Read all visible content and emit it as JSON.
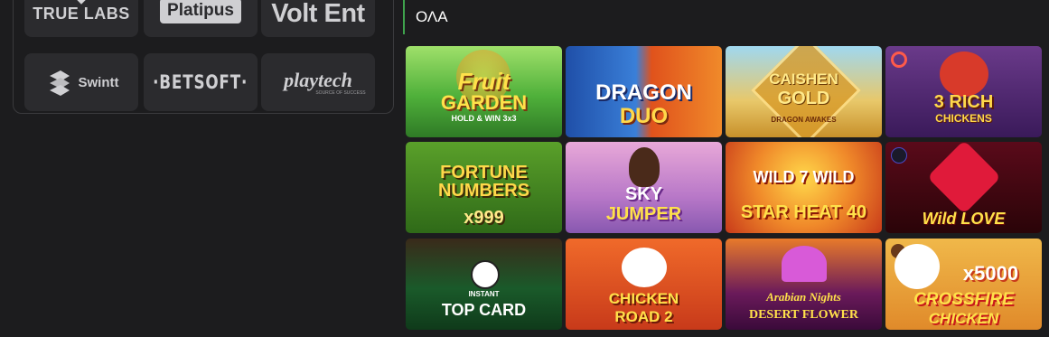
{
  "providers": {
    "truelabs": "TRUE LABS",
    "platipus": "Platipus",
    "voltent": "Volt Ent",
    "swintt": "Swintt",
    "betsoft": "·BETSOFT·",
    "playtech": "playtech",
    "playtech_tag": "SOURCE OF SUCCESS"
  },
  "search": {
    "value": "ΟΛΑ"
  },
  "games": [
    {
      "title1": "Fruit",
      "title2": "GARDEN",
      "sub": "HOLD & WIN 3x3"
    },
    {
      "title1": "DRAGON",
      "title2": "DUO",
      "sub": ""
    },
    {
      "title1": "CAISHEN",
      "title2": "GOLD",
      "sub": "DRAGON AWAKES"
    },
    {
      "title1": "3 RICH",
      "title2": "CHICKENS",
      "sub": ""
    },
    {
      "title1": "FORTUNE",
      "title2": "NUMBERS",
      "sub": "x999"
    },
    {
      "title1": "SKY",
      "title2": "JUMPER",
      "sub": ""
    },
    {
      "title1": "WILD 7 WILD",
      "title2": "STAR HEAT 40",
      "sub": ""
    },
    {
      "title1": "",
      "title2": "Wild LOVE",
      "sub": ""
    },
    {
      "title1": "INSTANT",
      "title2": "TOP CARD",
      "sub": ""
    },
    {
      "title1": "CHICKEN",
      "title2": "ROAD 2",
      "sub": ""
    },
    {
      "title1": "Arabian Nights",
      "title2": "DESERT FLOWER",
      "sub": ""
    },
    {
      "title1": "x5000",
      "title2": "CROSSFIRE",
      "sub": "CHICKEN"
    }
  ]
}
